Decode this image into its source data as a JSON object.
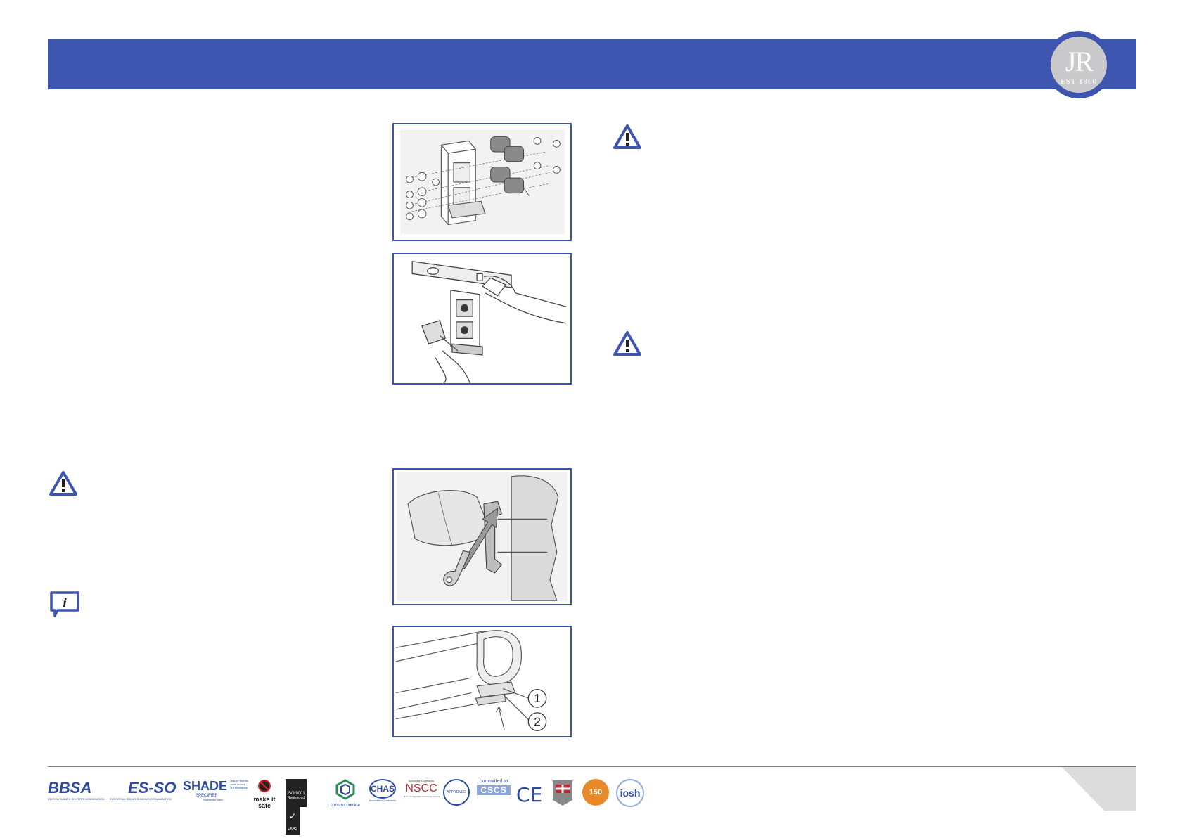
{
  "logo": {
    "monogram": "JR",
    "est": "EST 1860"
  },
  "figures": {
    "callout_1": "1",
    "callout_2": "2"
  },
  "footer_logos": {
    "bbsa": "BBSA",
    "bbsa_sub": "BRITISH BLIND & SHUTTER ASSOCIATION",
    "esso": "ES-SO",
    "esso_sub": "EUROPEAN SOLAR-SHADING ORGANIZATION",
    "shade": "SHADE",
    "shade_specifier": "SPECIFIER",
    "shade_tag": "reduce energy save money cut emissions",
    "shade_reg": "Registered User",
    "make_it_safe": "make it safe",
    "iso": "ISO 9001",
    "iso_reg": "Registered",
    "ukas": "UKAS",
    "constructionline": "constructionline",
    "chas": "CHAS",
    "chas_sub": "Accredited Contractor",
    "nscc_top": "Specialist Contractor",
    "nscc": "NSCC",
    "nscc_sub": "National Specialist Contractors Council",
    "approved": "APPROVED",
    "cscs_top": "committed to",
    "cscs": "CSCS",
    "ce": "CE",
    "years": "150",
    "iosh": "iosh"
  }
}
